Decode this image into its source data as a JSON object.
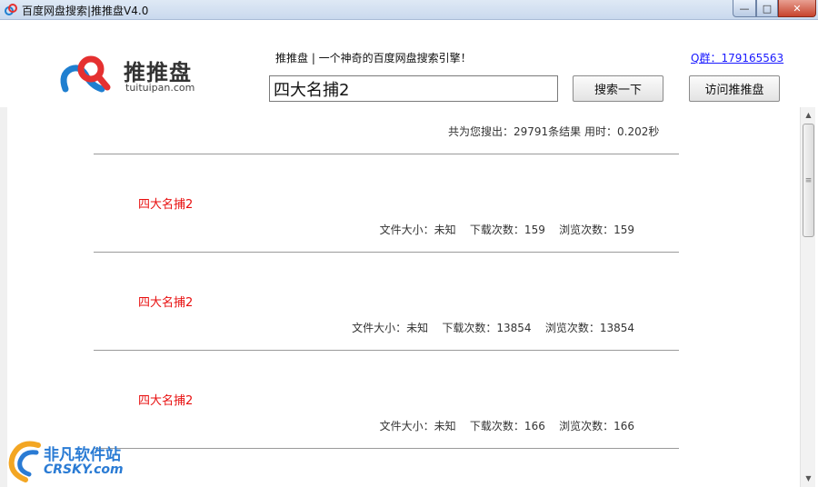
{
  "window": {
    "title": "百度网盘搜索|推推盘V4.0",
    "controls": {
      "minimize": "—",
      "maximize": "□",
      "close": "✕"
    }
  },
  "header": {
    "logo_cn": "推推盘",
    "logo_en": "tuituipan.com",
    "slogan": "推推盘 | 一个神奇的百度网盘搜索引擎！",
    "qq_group": "Q群：179165563",
    "search_value": "四大名捕2",
    "search_button": "搜索一下",
    "visit_button": "访问推推盘"
  },
  "summary": "共为您搜出：29791条结果 用时：0.202秒",
  "results": [
    {
      "title": "四大名捕2",
      "meta": "文件大小：未知    下载次数：159    浏览次数：159"
    },
    {
      "title": "四大名捕2",
      "meta": "文件大小：未知    下载次数：13854    浏览次数：13854"
    },
    {
      "title": "四大名捕2",
      "meta": "文件大小：未知    下载次数：166    浏览次数：166"
    }
  ],
  "watermark": {
    "cn": "非凡软件站",
    "en": "CRSKY.com"
  },
  "colors": {
    "result_title": "#e81010",
    "link": "#1a1aff",
    "logo_red": "#e53030",
    "logo_blue": "#1f7fd0"
  }
}
